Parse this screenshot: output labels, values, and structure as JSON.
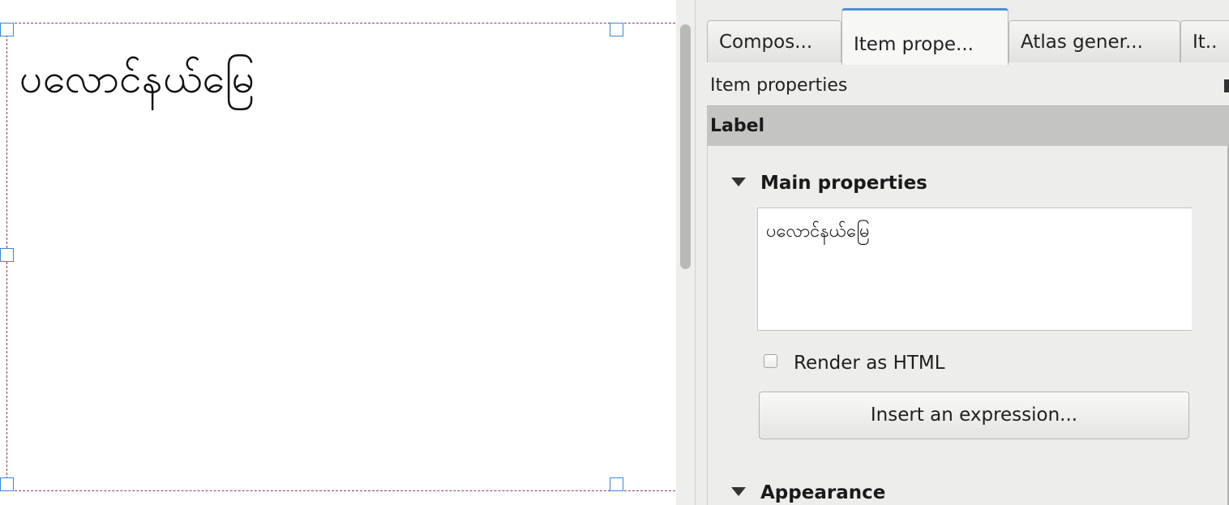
{
  "canvas": {
    "label_text": "ပလောင်နယ်မြေ"
  },
  "tabs": [
    {
      "label": "Compos..."
    },
    {
      "label": "Item prope..."
    },
    {
      "label": "Atlas gener..."
    },
    {
      "label": "It.."
    }
  ],
  "active_tab_index": 1,
  "panel": {
    "title": "Item properties",
    "section_header": "Label",
    "main_properties": {
      "title": "Main properties",
      "text_value": "ပလောင်နယ်မြေ",
      "render_html_label": "Render as HTML",
      "render_html_checked": false,
      "insert_expression_label": "Insert an expression..."
    },
    "appearance_title": "Appearance"
  },
  "colors": {
    "frame_border": "#8a3a6a",
    "handle_border": "#3b87d0",
    "active_tab_accent": "#4a90d9",
    "section_header_bg": "#c4c4c2"
  }
}
